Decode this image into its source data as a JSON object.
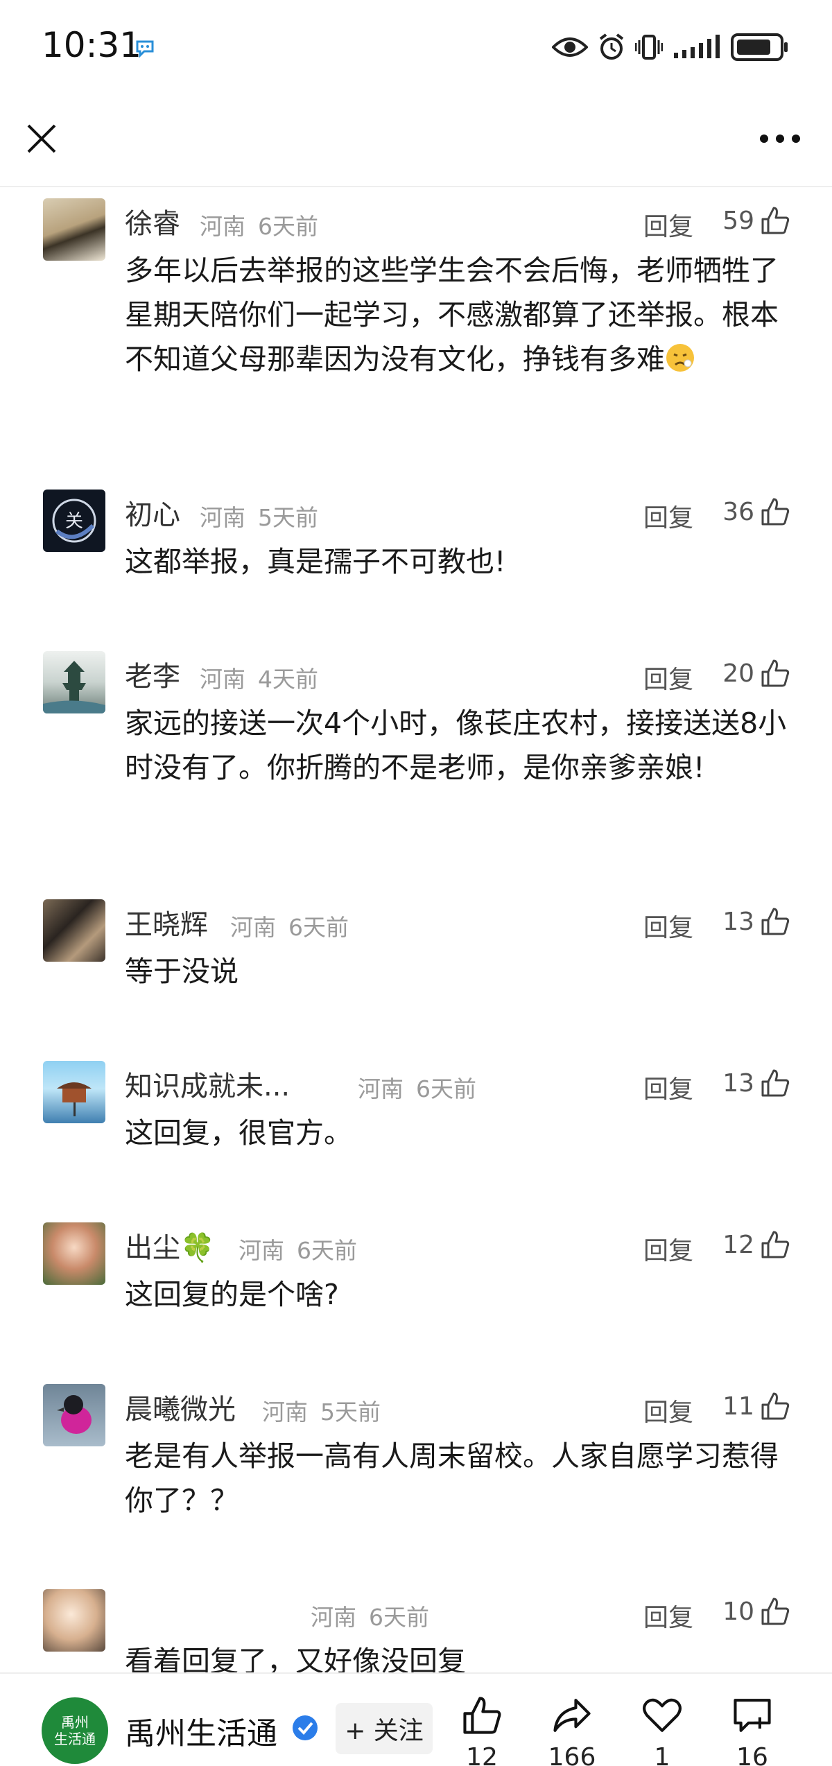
{
  "status_bar": {
    "time": "10:31"
  },
  "comments": [
    {
      "name": "徐睿",
      "region": "河南",
      "time": "6天前",
      "reply": "回复",
      "likes": "59",
      "text": "多年以后去举报的这些学生会不会后悔，老师牺牲了星期天陪你们一起学习，不感激都算了还举报。根本不知道父母那辈因为没有文化，挣钱有多难"
    },
    {
      "name": "初心",
      "region": "河南",
      "time": "5天前",
      "reply": "回复",
      "likes": "36",
      "text": "这都举报，真是孺子不可教也!"
    },
    {
      "name": "老李",
      "region": "河南",
      "time": "4天前",
      "reply": "回复",
      "likes": "20",
      "text": "家远的接送一次4个小时，像苌庄农村，接接送送8小时没有了。你折腾的不是老师，是你亲爹亲娘!"
    },
    {
      "name": "王晓辉",
      "region": "河南",
      "time": "6天前",
      "reply": "回复",
      "likes": "13",
      "text": "等于没说"
    },
    {
      "name": "知识成就未...",
      "region": "河南",
      "time": "6天前",
      "reply": "回复",
      "likes": "13",
      "text": "这回复，很官方。"
    },
    {
      "name": "出尘🍀",
      "region": "河南",
      "time": "6天前",
      "reply": "回复",
      "likes": "12",
      "text": "这回复的是个啥?"
    },
    {
      "name": "晨曦微光",
      "region": "河南",
      "time": "5天前",
      "reply": "回复",
      "likes": "11",
      "text": "老是有人举报一高有人周末留校。人家自愿学习惹得你了？？"
    },
    {
      "name": "",
      "region": "河南",
      "time": "6天前",
      "reply": "回复",
      "likes": "10",
      "text": "看着回复了，又好像没回复"
    }
  ],
  "bottom_bar": {
    "logo_line1": "禹州",
    "logo_line2": "生活通",
    "account_name": "禹州生活通",
    "follow_label": "+ 关注",
    "like_count": "12",
    "share_count": "166",
    "favorite_count": "1",
    "comment_count": "16"
  }
}
